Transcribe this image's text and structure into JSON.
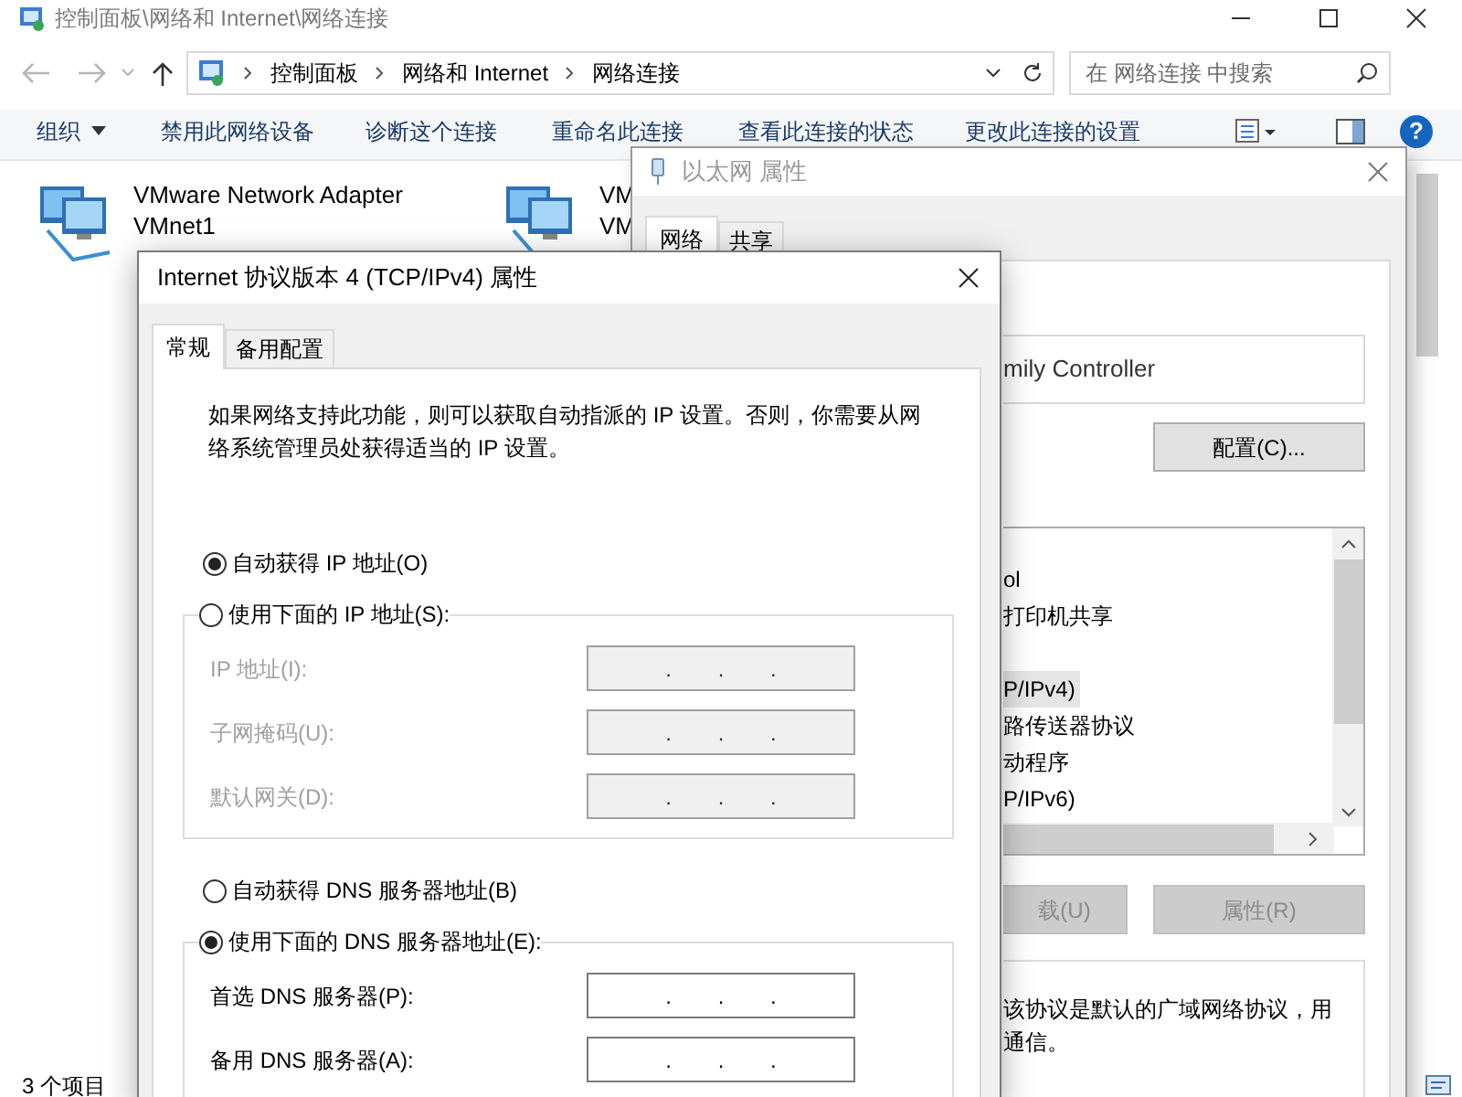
{
  "explorer": {
    "title": "控制面板\\网络和 Internet\\网络连接",
    "address": {
      "crumbs": [
        "控制面板",
        "网络和 Internet",
        "网络连接"
      ]
    },
    "search": {
      "placeholder": "在 网络连接 中搜索"
    },
    "toolbar": [
      {
        "label": "组织",
        "dropdown": true
      },
      {
        "label": "禁用此网络设备",
        "dropdown": false
      },
      {
        "label": "诊断这个连接",
        "dropdown": false
      },
      {
        "label": "重命名此连接",
        "dropdown": false
      },
      {
        "label": "查看此连接的状态",
        "dropdown": false
      },
      {
        "label": "更改此连接的设置",
        "dropdown": false
      }
    ],
    "help": "?",
    "items": [
      {
        "name": "VMware Network Adapter",
        "detail": "VMnet1"
      },
      {
        "name": "VM",
        "detail": "VM"
      }
    ],
    "status_bar": "3 个项目"
  },
  "ethernet_dialog": {
    "title": "以太网 属性",
    "tabs": [
      {
        "label": "网络",
        "selected": true
      },
      {
        "label": "共享",
        "selected": false
      }
    ],
    "adapter": "mily Controller",
    "configure_button": "配置(C)...",
    "components": [
      {
        "label": "ol",
        "selected": false
      },
      {
        "label": "打印机共享",
        "selected": false
      },
      {
        "selected": false
      },
      {
        "label": "P/IPv4)",
        "selected": true
      },
      {
        "label": "路传送器协议",
        "selected": false
      },
      {
        "label": "动程序",
        "selected": false
      },
      {
        "label": "P/IPv6)",
        "selected": false
      }
    ],
    "buttons": [
      {
        "label": "载(U)",
        "disabled": true
      },
      {
        "label": "属性(R)",
        "disabled": true
      }
    ],
    "description": [
      "该协议是默认的广域网络协议，用",
      "通信。"
    ]
  },
  "ipv4_dialog": {
    "title": "Internet 协议版本 4 (TCP/IPv4) 属性",
    "tabs": [
      {
        "label": "常规",
        "selected": true
      },
      {
        "label": "备用配置",
        "selected": false
      }
    ],
    "intro": "如果网络支持此功能，则可以获取自动指派的 IP 设置。否则，你需要从网络系统管理员处获得适当的 IP 设置。",
    "ip_modes": [
      {
        "label": "自动获得 IP 地址(O)",
        "selected": true
      },
      {
        "label": "使用下面的 IP 地址(S):",
        "selected": false
      }
    ],
    "ip_fields": [
      {
        "label": "IP 地址(I):",
        "value": ". . .",
        "disabled": true
      },
      {
        "label": "子网掩码(U):",
        "value": ". . .",
        "disabled": true
      },
      {
        "label": "默认网关(D):",
        "value": ". . .",
        "disabled": true
      }
    ],
    "dns_modes": [
      {
        "label": "自动获得 DNS 服务器地址(B)",
        "selected": false
      },
      {
        "label": "使用下面的 DNS 服务器地址(E):",
        "selected": true
      }
    ],
    "dns_fields": [
      {
        "label": "首选 DNS 服务器(P):",
        "value": ". . .",
        "disabled": false
      },
      {
        "label": "备用 DNS 服务器(A):",
        "value": ". . .",
        "disabled": false
      }
    ]
  }
}
